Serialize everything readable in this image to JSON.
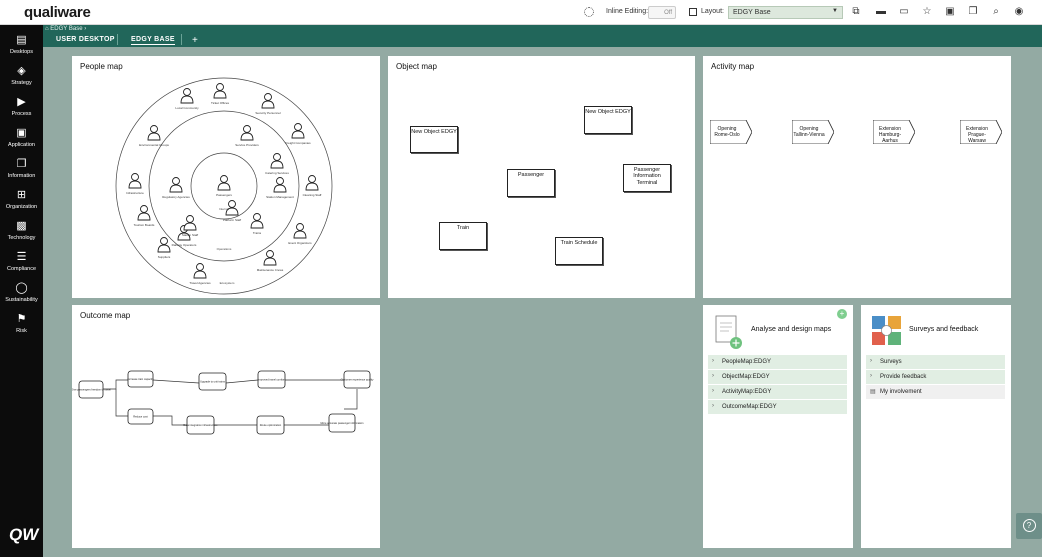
{
  "app": {
    "logo": "qualiware"
  },
  "toolbar": {
    "inline_editing_label": "Inline Editing:",
    "inline_editing_value": "Off",
    "layout_label": "Layout:",
    "layout_value": "EDGY Base"
  },
  "sidebar": {
    "items": [
      {
        "label": "Desktops",
        "icon": "desktops-icon"
      },
      {
        "label": "Strategy",
        "icon": "strategy-icon"
      },
      {
        "label": "Process",
        "icon": "process-icon"
      },
      {
        "label": "Application",
        "icon": "application-icon"
      },
      {
        "label": "Information",
        "icon": "information-icon"
      },
      {
        "label": "Organization",
        "icon": "organization-icon"
      },
      {
        "label": "Technology",
        "icon": "technology-icon"
      },
      {
        "label": "Compliance",
        "icon": "compliance-icon"
      },
      {
        "label": "Sustainability",
        "icon": "sustainability-icon"
      },
      {
        "label": "Risk",
        "icon": "risk-icon"
      }
    ],
    "footer_logo": "QW"
  },
  "breadcrumb": {
    "label": "EDGY Base"
  },
  "tabs": [
    {
      "label": "USER DESKTOP",
      "active": false
    },
    {
      "label": "EDGY BASE",
      "active": true
    }
  ],
  "add_tab": "+",
  "panels": {
    "people_map": {
      "title": "People map",
      "labels": [
        "Passengers",
        "Railway Operators",
        "Regulatory Agencies",
        "Station Staff",
        "Service Providers",
        "Catering Services",
        "Station Management",
        "Trains",
        "Platform Staff",
        "Local Community",
        "Ticket Offices",
        "Security Personnel",
        "Freight Companies",
        "Cleaning Staff",
        "Event Organizers",
        "Maintenance Crews",
        "Travel Agencies",
        "Suppliers",
        "Tourism Boards",
        "Infrastructure",
        "Environmental Groups"
      ],
      "ring_labels": [
        "Internal",
        "Operations",
        "Ecosystem"
      ]
    },
    "object_map": {
      "title": "Object map",
      "objects": [
        "New Object EDGY",
        "New Object EDGY",
        "Passenger",
        "Passenger Information Terminal",
        "Train",
        "Train Schedule"
      ]
    },
    "activity_map": {
      "title": "Activity map",
      "activities": [
        "Opening Rome-Oslo",
        "Opening Tallinn-Vienna",
        "Extension Hamburg-Aarhus",
        "Extension Prague-Warsaw"
      ]
    },
    "outcome_map": {
      "title": "Outcome map",
      "nodes": [
        "Give passengers freedom to travel",
        "Increase train capacity",
        "Upgrade to unit trains",
        "Improved travel comfort",
        "Customer experience quality",
        "Reduce cost",
        "Data integration infrastructure",
        "Route optimization",
        "More accurate passenger information"
      ]
    },
    "analyse": {
      "title": "Analyse and design maps",
      "items": [
        "PeopleMap:EDGY",
        "ObjectMap:EDGY",
        "ActivityMap:EDGY",
        "OutcomeMap:EDGY"
      ]
    },
    "surveys": {
      "title": "Surveys and feedback",
      "items": [
        "Surveys",
        "Provide feedback"
      ],
      "involvement": "My involvement"
    }
  },
  "help": "?"
}
